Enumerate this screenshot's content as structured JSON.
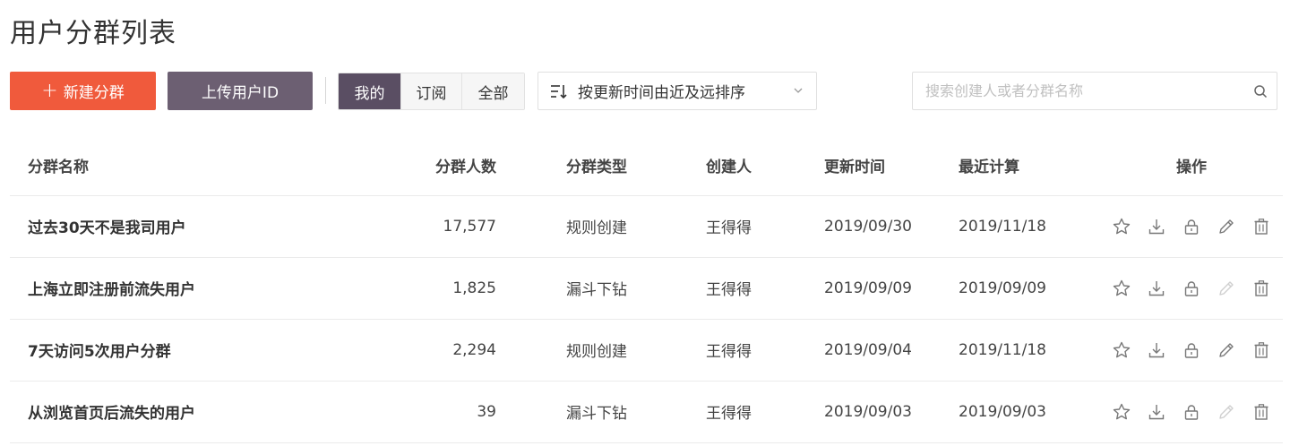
{
  "page": {
    "title": "用户分群列表"
  },
  "toolbar": {
    "new_label": "新建分群",
    "upload_label": "上传用户ID",
    "filters": [
      {
        "label": "我的",
        "active": true
      },
      {
        "label": "订阅",
        "active": false
      },
      {
        "label": "全部",
        "active": false
      }
    ],
    "sort_label": "按更新时间由近及远排序",
    "search_placeholder": "搜索创建人或者分群名称"
  },
  "colors": {
    "primary": "#f05a3c",
    "secondary": "#6c5f72",
    "active_tab": "#5a4e63"
  },
  "table": {
    "headers": {
      "name": "分群名称",
      "count": "分群人数",
      "type": "分群类型",
      "creator": "创建人",
      "updated": "更新时间",
      "calculated": "最近计算",
      "ops": "操作"
    },
    "rows": [
      {
        "name": "过去30天不是我司用户",
        "count": "17,577",
        "type": "规则创建",
        "creator": "王得得",
        "updated": "2019/09/30",
        "calculated": "2019/11/18",
        "edit_enabled": true
      },
      {
        "name": "上海立即注册前流失用户",
        "count": "1,825",
        "type": "漏斗下钻",
        "creator": "王得得",
        "updated": "2019/09/09",
        "calculated": "2019/09/09",
        "edit_enabled": false
      },
      {
        "name": "7天访问5次用户分群",
        "count": "2,294",
        "type": "规则创建",
        "creator": "王得得",
        "updated": "2019/09/04",
        "calculated": "2019/11/18",
        "edit_enabled": true
      },
      {
        "name": "从浏览首页后流失的用户",
        "count": "39",
        "type": "漏斗下钻",
        "creator": "王得得",
        "updated": "2019/09/03",
        "calculated": "2019/09/03",
        "edit_enabled": false
      }
    ],
    "op_icons": [
      "star-icon",
      "download-icon",
      "lock-icon",
      "pencil-icon",
      "trash-icon"
    ]
  }
}
